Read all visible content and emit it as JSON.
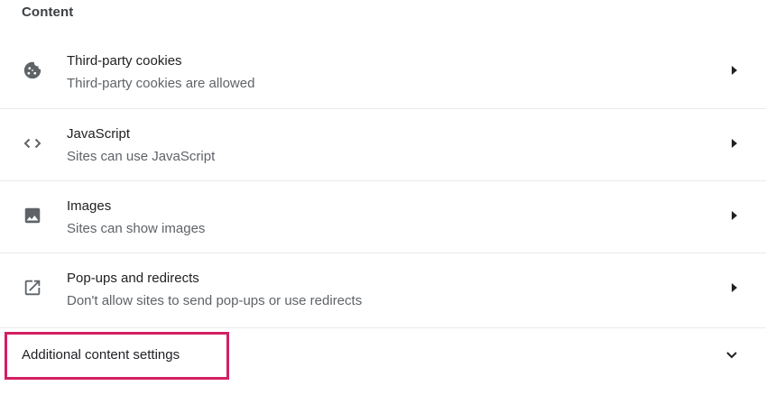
{
  "section": {
    "title": "Content"
  },
  "rows": [
    {
      "label": "Third-party cookies",
      "sublabel": "Third-party cookies are allowed",
      "icon": "cookie-icon"
    },
    {
      "label": "JavaScript",
      "sublabel": "Sites can use JavaScript",
      "icon": "code-icon"
    },
    {
      "label": "Images",
      "sublabel": "Sites can show images",
      "icon": "image-icon"
    },
    {
      "label": "Pop-ups and redirects",
      "sublabel": "Don't allow sites to send pop-ups or use redirects",
      "icon": "open-in-new-icon"
    }
  ],
  "additional": {
    "label": "Additional content settings",
    "icon": "chevron-down-icon"
  },
  "colors": {
    "highlight": "#d31f63",
    "divider": "#e8eaed",
    "icon": "#5f6368"
  }
}
